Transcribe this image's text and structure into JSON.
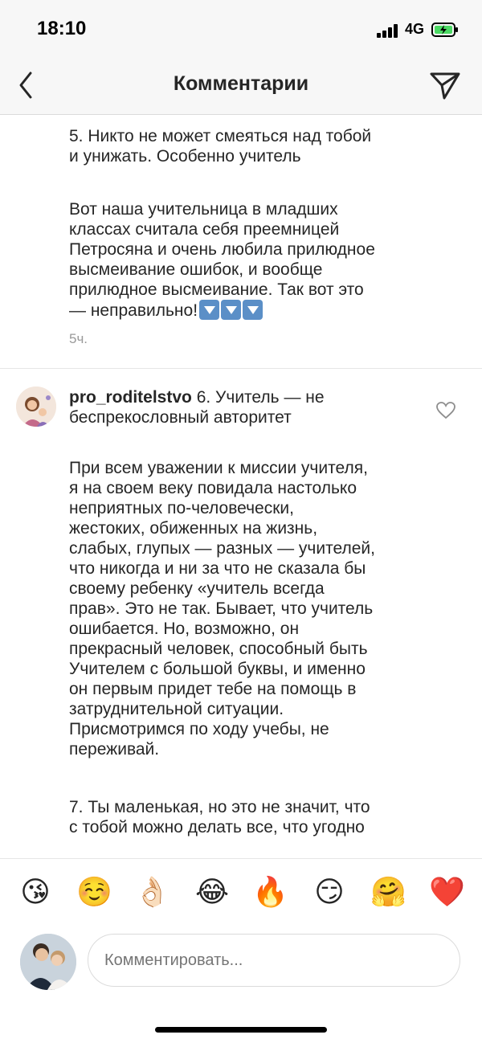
{
  "status_bar": {
    "time": "18:10",
    "network": "4G"
  },
  "nav": {
    "title": "Комментарии"
  },
  "comment_prev": {
    "text_a": "5. Никто не может смеяться над тобой\nи унижать. Особенно учитель",
    "text_b": "Вот наша учительница в младших\nклассах считала себя преемницей\nПетросяна и очень любила прилюдное\nвысмеивание ошибок, и вообще\nприлюдное высмеивание. Так вот это\n— неправильно!",
    "emoji_count": 3,
    "time": "5ч."
  },
  "comment_main": {
    "username": "pro_roditelstvo",
    "head_text": " 6. Учитель — не\nбеспрекословный авторитет",
    "body": "При всем уважении к миссии учителя,\nя на своем веку повидала настолько\nнеприятных по-человечески,\nжестоких, обиженных на жизнь,\nслабых, глупых — разных — учителей,\nчто никогда и ни за что не сказала бы\nсвоему ребенку «учитель всегда\nправ». Это не так. Бывает, что учитель\nошибается. Но, возможно, он\nпрекрасный человек, способный быть\nУчителем с большой буквы, и именно\nон первым придет тебе на помощь в\nзатруднительной ситуации.\nПрисмотримся по ходу учебы, не\nпереживай.",
    "body2": "7. Ты маленькая, но это не значит, что\nс тобой можно делать все, что угодно"
  },
  "emoji_bar": [
    {
      "name": "face-blowing-kiss",
      "glyph": "😘"
    },
    {
      "name": "smiling-face",
      "glyph": "☺️"
    },
    {
      "name": "ok-hand",
      "glyph": "👌🏻"
    },
    {
      "name": "tears-of-joy",
      "glyph": "😂"
    },
    {
      "name": "fire",
      "glyph": "🔥"
    },
    {
      "name": "smirking-face",
      "glyph": "😏"
    },
    {
      "name": "hugging-face",
      "glyph": "🤗"
    },
    {
      "name": "red-heart",
      "glyph": "❤️"
    }
  ],
  "composer": {
    "placeholder": "Комментировать..."
  },
  "colors": {
    "accent_blue": "#5b8fc7",
    "text": "#262626",
    "muted": "#999999",
    "battery_green": "#4cd964"
  }
}
